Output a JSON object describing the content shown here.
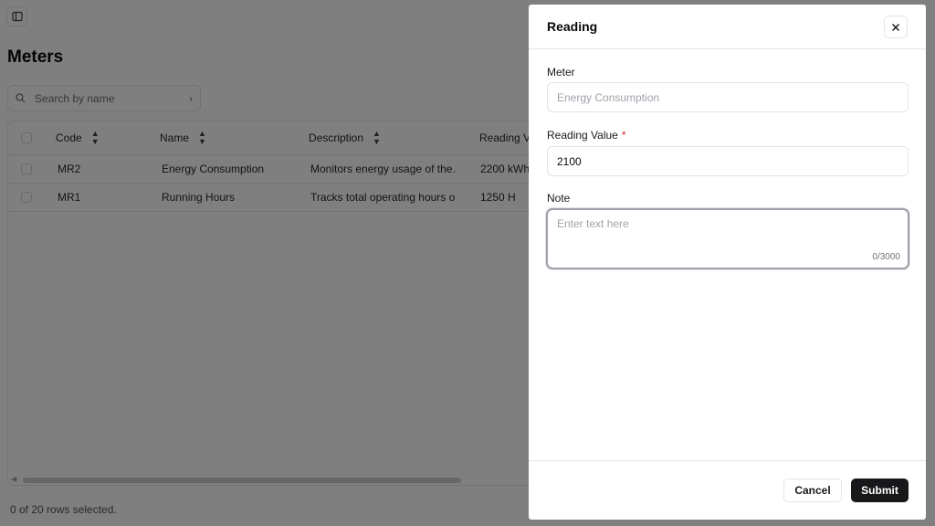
{
  "page": {
    "title": "Meters",
    "search": {
      "placeholder": "Search by name"
    },
    "status": "0 of 20 rows selected."
  },
  "table": {
    "columns": [
      "Code",
      "Name",
      "Description",
      "Reading Va"
    ],
    "rows": [
      {
        "code": "MR2",
        "name": "Energy Consumption",
        "description": "Monitors energy usage of the…",
        "reading": "2200 kWh"
      },
      {
        "code": "MR1",
        "name": "Running Hours",
        "description": "Tracks total operating hours o…",
        "reading": "1250 H"
      }
    ]
  },
  "sheet": {
    "title": "Reading",
    "meter": {
      "label": "Meter",
      "value": "Energy Consumption"
    },
    "reading_value": {
      "label": "Reading Value",
      "required_mark": "*",
      "value": "2100"
    },
    "note": {
      "label": "Note",
      "placeholder": "Enter text here",
      "counter": "0/3000"
    },
    "cancel_label": "Cancel",
    "submit_label": "Submit"
  }
}
